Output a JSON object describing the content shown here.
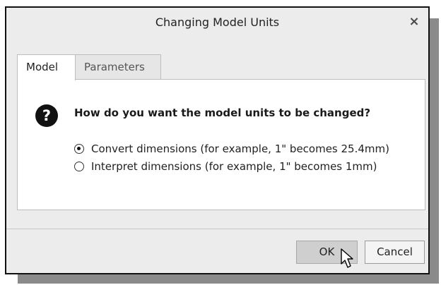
{
  "dialog": {
    "title": "Changing Model Units",
    "close_glyph": "×"
  },
  "tabs": [
    {
      "label": "Model",
      "active": true
    },
    {
      "label": "Parameters",
      "active": false
    }
  ],
  "content": {
    "icon": "question-icon",
    "question": "How do you want the model units to be changed?",
    "options": [
      {
        "label": "Convert dimensions (for example, 1\" becomes 25.4mm)",
        "selected": true
      },
      {
        "label": "Interpret dimensions (for example, 1\" becomes 1mm)",
        "selected": false
      }
    ]
  },
  "buttons": {
    "ok": "OK",
    "cancel": "Cancel"
  },
  "colors": {
    "dialog_bg": "#ececec",
    "panel_bg": "#ffffff",
    "ok_bg": "#cfcfcf"
  }
}
